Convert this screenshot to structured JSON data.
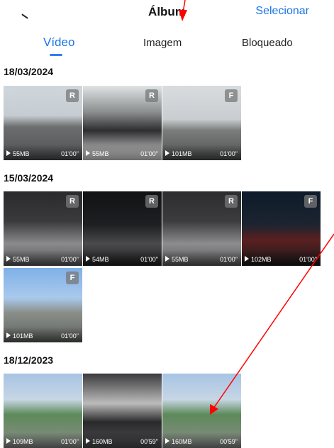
{
  "header": {
    "title": "Álbum",
    "select_label": "Selecionar"
  },
  "tabs": [
    {
      "label": "Vídeo",
      "active": true
    },
    {
      "label": "Imagem",
      "active": false
    },
    {
      "label": "Bloqueado",
      "active": false
    }
  ],
  "groups": [
    {
      "date": "18/03/2024",
      "items": [
        {
          "badge": "R",
          "size": "55MB",
          "duration": "01'00\""
        },
        {
          "badge": "R",
          "size": "55MB",
          "duration": "01'00\""
        },
        {
          "badge": "F",
          "size": "101MB",
          "duration": "01'00\""
        }
      ]
    },
    {
      "date": "15/03/2024",
      "items": [
        {
          "badge": "R",
          "size": "55MB",
          "duration": "01'00\""
        },
        {
          "badge": "R",
          "size": "54MB",
          "duration": "01'00\""
        },
        {
          "badge": "R",
          "size": "55MB",
          "duration": "01'00\""
        },
        {
          "badge": "F",
          "size": "102MB",
          "duration": "01'00\""
        },
        {
          "badge": "F",
          "size": "101MB",
          "duration": "01'00\""
        }
      ]
    },
    {
      "date": "18/12/2023",
      "items": [
        {
          "badge": "",
          "size": "109MB",
          "duration": "01'00\""
        },
        {
          "badge": "",
          "size": "160MB",
          "duration": "00'59\""
        },
        {
          "badge": "",
          "size": "160MB",
          "duration": "00'59\""
        }
      ]
    }
  ],
  "colors": {
    "accent": "#1a73e8",
    "annotation": "#ff0000"
  }
}
